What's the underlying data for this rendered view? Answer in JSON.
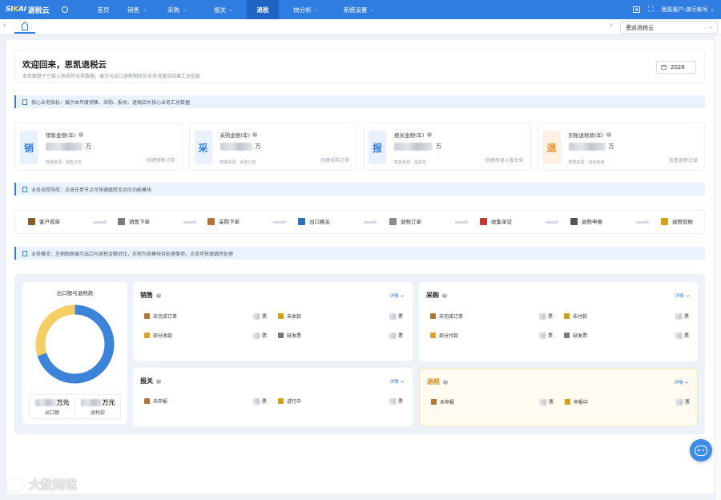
{
  "app": {
    "brand_prefix": "SI",
    "brand_k": "K",
    "brand_suffix": "AI",
    "brand_name": "退税云"
  },
  "nav": [
    {
      "label": "首页",
      "chev": ""
    },
    {
      "label": "销售",
      "chev": "⌄"
    },
    {
      "label": "采购",
      "chev": "⌄"
    },
    {
      "label": "报关",
      "chev": "⌄"
    },
    {
      "label": "退税",
      "chev": ""
    },
    {
      "label": "快分析",
      "chev": "⌄"
    },
    {
      "label": "系统设置",
      "chev": "⌄"
    }
  ],
  "top_right": {
    "account": "思凯账户:演示帐号",
    "chev": "⌄"
  },
  "tabbar": {
    "prev": "‹",
    "next": "›",
    "left": "‹",
    "company": "思凯退税云",
    "chev": "⌄"
  },
  "welcome": {
    "title": "欢迎回来，思凯退税云",
    "subtitle": "本页面基于已接入系统的业务数据，展示与出口退税相关的业务进度及结果汇总信息",
    "year": "2026"
  },
  "sections": {
    "core": "核心业务指标：展示本年度销售、采购、报关、退税四大核心业务汇总数据",
    "flow": "业务流程导航：点击任意节点可快速跳转至对应功能模块",
    "overview": "业务概览：左侧图表展示出口与退税金额对比，右侧为各模块待处理事项，点击可快速跳转处理"
  },
  "cards": [
    {
      "badge": "销",
      "label": "销售金额(年)",
      "unit": "万",
      "source": "数据来源：销售订单",
      "link": "创建销售订单",
      "color": "#2f7de1",
      "bg": "#e8f1fd"
    },
    {
      "badge": "采",
      "label": "采购金额(年)",
      "unit": "万",
      "source": "数据来源：采购订单",
      "link": "创建采购订单",
      "color": "#2f7de1",
      "bg": "#e8f1fd"
    },
    {
      "badge": "报",
      "label": "报关金额(年)",
      "unit": "万",
      "source": "数据来源：报关单",
      "link": "创建预录入报关单",
      "color": "#2f7de1",
      "bg": "#e8f1fd"
    },
    {
      "badge": "退",
      "label": "到账退税款(年)",
      "unit": "万",
      "source": "数据来源：退税到账",
      "link": "查看退税记录",
      "color": "#f08a24",
      "bg": "#fdf0e3"
    }
  ],
  "flow_steps": [
    {
      "label": "客户成单",
      "icon": "cart-icon",
      "color": "#8a5a2b"
    },
    {
      "label": "销售下单",
      "icon": "doc-icon",
      "color": "#7a7a7a"
    },
    {
      "label": "采购下单",
      "icon": "package-icon",
      "color": "#b0753a"
    },
    {
      "label": "出口报关",
      "icon": "ship-icon",
      "color": "#2f6fb5"
    },
    {
      "label": "退税订单",
      "icon": "list-icon",
      "color": "#8a8a8a"
    },
    {
      "label": "收集单证",
      "icon": "file-icon",
      "color": "#c0392b"
    },
    {
      "label": "退税申报",
      "icon": "flag-icon",
      "color": "#555555"
    },
    {
      "label": "退税到账",
      "icon": "money-bag-icon",
      "color": "#d4a017"
    }
  ],
  "donut": {
    "title": "出口额与退税款",
    "unit": "万元",
    "export_label": "出口额",
    "refund_label": "退税款",
    "colors": {
      "export": "#3b84d9",
      "refund": "#f5cf66"
    }
  },
  "panels": {
    "sales": {
      "title": "销售",
      "link": "详情 →",
      "items": [
        {
          "label": "未完成订单",
          "unit": "票"
        },
        {
          "label": "未收款",
          "unit": "票"
        },
        {
          "label": "部分收款",
          "unit": "票"
        },
        {
          "label": "缺发票",
          "unit": "票"
        }
      ]
    },
    "purchase": {
      "title": "采购",
      "link": "详情 →",
      "items": [
        {
          "label": "未完成订单",
          "unit": "票"
        },
        {
          "label": "未付款",
          "unit": "票"
        },
        {
          "label": "部分付款",
          "unit": "票"
        },
        {
          "label": "缺发票",
          "unit": "票"
        }
      ]
    },
    "customs": {
      "title": "报关",
      "link": "详情 →",
      "items": [
        {
          "label": "未申报",
          "unit": "票"
        },
        {
          "label": "进行中",
          "unit": "票"
        }
      ]
    },
    "refund": {
      "title": "退税",
      "link": "详情 →",
      "items": [
        {
          "label": "未申报",
          "unit": "票"
        },
        {
          "label": "申报中",
          "unit": "票"
        }
      ]
    }
  },
  "watermark": "大数跨境"
}
